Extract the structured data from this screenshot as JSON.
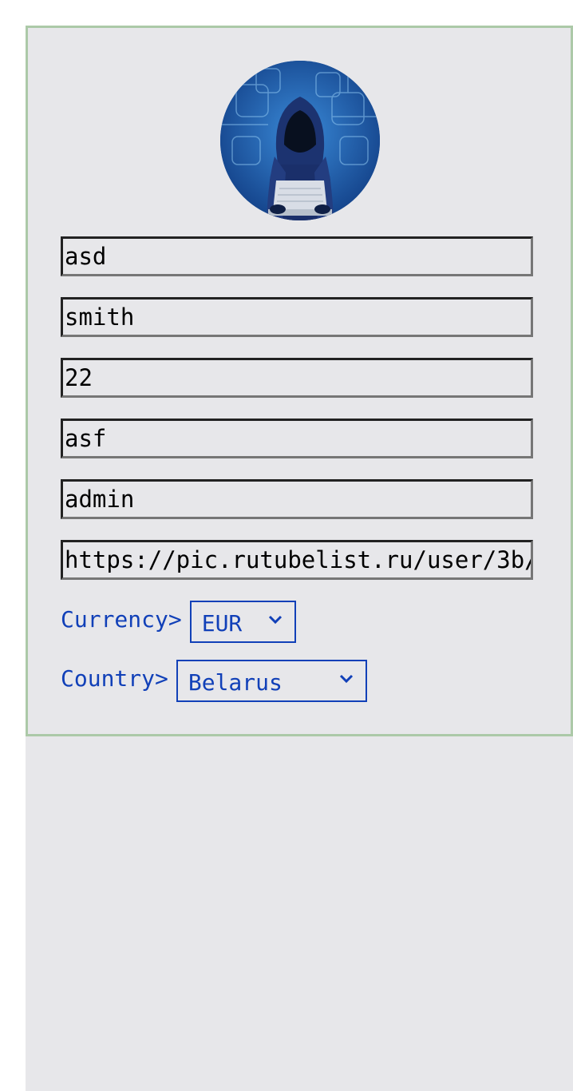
{
  "profile": {
    "avatar_icon": "hooded-hacker-avatar",
    "fields": [
      {
        "value": "asd"
      },
      {
        "value": "smith"
      },
      {
        "value": "22"
      },
      {
        "value": "asf"
      },
      {
        "value": "admin"
      },
      {
        "value": "https://pic.rutubelist.ru/user/3b/"
      }
    ]
  },
  "currency": {
    "label": "Currency>",
    "selected": "EUR"
  },
  "country": {
    "label": "Country>",
    "selected": "Belarus"
  },
  "colors": {
    "accent": "#1140b8",
    "card_border": "#acc9a8",
    "background": "#e7e7ea"
  }
}
